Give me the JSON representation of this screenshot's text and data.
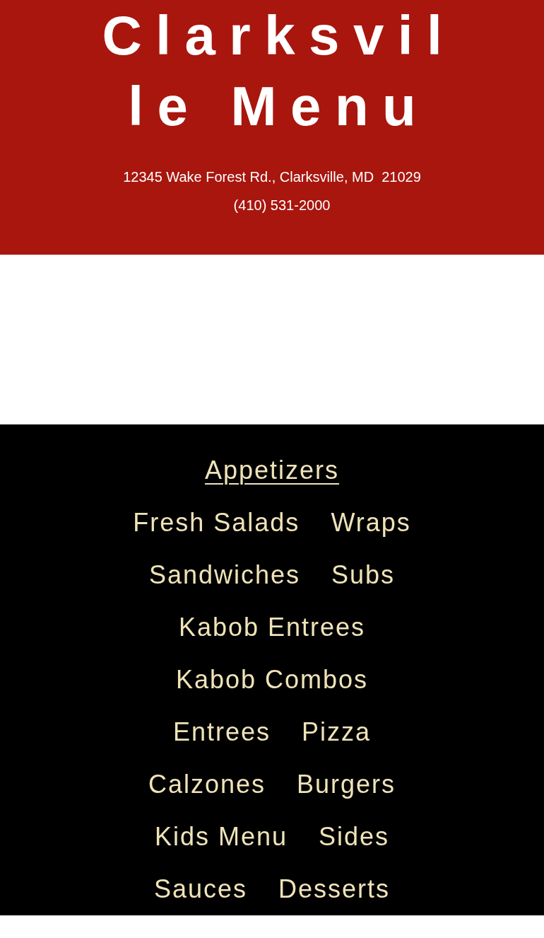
{
  "header": {
    "title": "Clarksville Menu",
    "address": "12345 Wake Forest Rd., Clarksville, MD  21029",
    "phone": "(410) 531-2000"
  },
  "menu_rows": [
    [
      {
        "label": "Appetizers",
        "selected": true
      }
    ],
    [
      {
        "label": "Fresh Salads",
        "selected": false
      },
      {
        "label": "Wraps",
        "selected": false
      }
    ],
    [
      {
        "label": "Sandwiches",
        "selected": false
      },
      {
        "label": "Subs",
        "selected": false
      }
    ],
    [
      {
        "label": "Kabob Entrees",
        "selected": false
      }
    ],
    [
      {
        "label": "Kabob Combos",
        "selected": false
      }
    ],
    [
      {
        "label": "Entrees",
        "selected": false
      },
      {
        "label": "Pizza",
        "selected": false
      }
    ],
    [
      {
        "label": "Calzones",
        "selected": false
      },
      {
        "label": "Burgers",
        "selected": false
      }
    ],
    [
      {
        "label": "Kids Menu",
        "selected": false
      },
      {
        "label": "Sides",
        "selected": false
      }
    ],
    [
      {
        "label": "Sauces",
        "selected": false
      },
      {
        "label": "Desserts",
        "selected": false
      }
    ]
  ]
}
